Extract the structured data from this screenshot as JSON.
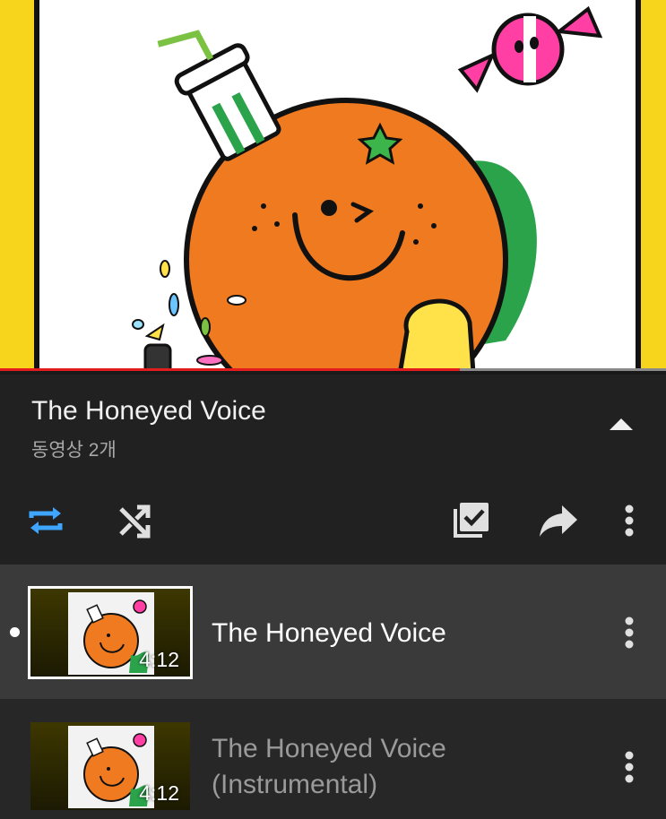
{
  "video": {
    "artwork": "orange-character-illustration",
    "progress_fraction": 0.69
  },
  "playlist": {
    "title": "The Honeyed Voice",
    "subtitle": "동영상 2개"
  },
  "actions": {
    "loop_icon": "loop-icon",
    "loop_color": "#3ea6ff",
    "shuffle_icon": "shuffle-icon",
    "save_icon": "save-to-library-icon",
    "share_icon": "share-icon",
    "more_icon": "more-vertical-icon",
    "collapse_icon": "collapse-up-icon"
  },
  "items": [
    {
      "title": "The Honeyed Voice",
      "duration": "4:12",
      "now_playing": true
    },
    {
      "title": "The Honeyed Voice (Instrumental)",
      "duration": "4:12",
      "now_playing": false
    }
  ]
}
